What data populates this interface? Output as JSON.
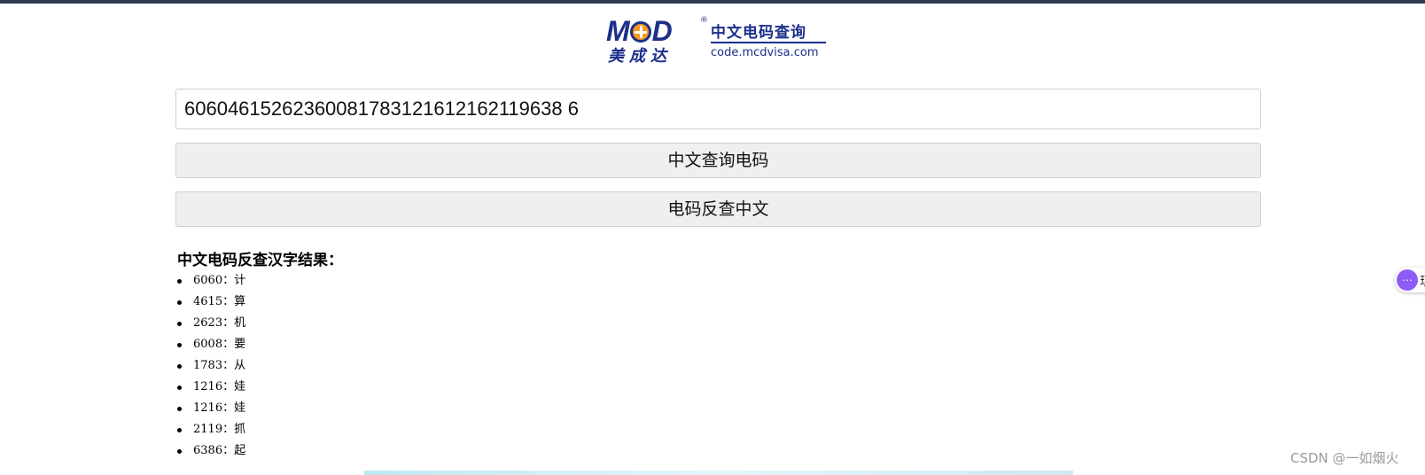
{
  "header": {
    "logo_brand": "MCD",
    "logo_chinese": "美成达",
    "logo_title": "中文电码查询",
    "logo_url": "code.mcdvisa.com"
  },
  "form": {
    "code_value": "60604615262360081783121612162119638 6",
    "query_button": "中文查询电码",
    "reverse_button": "电码反查中文"
  },
  "results": {
    "title": "中文电码反查汉字结果：",
    "items": [
      {
        "code": "6060",
        "char": "计"
      },
      {
        "code": "4615",
        "char": "算"
      },
      {
        "code": "2623",
        "char": "机"
      },
      {
        "code": "6008",
        "char": "要"
      },
      {
        "code": "1783",
        "char": "从"
      },
      {
        "code": "1216",
        "char": "娃"
      },
      {
        "code": "1216",
        "char": "娃"
      },
      {
        "code": "2119",
        "char": "抓"
      },
      {
        "code": "6386",
        "char": "起"
      }
    ]
  },
  "widget": {
    "chat_icon": "chat-bubble-icon",
    "chat_label": "现"
  },
  "watermark": "CSDN @一如烟火",
  "colors": {
    "brand_blue": "#1c2f8a",
    "brand_orange": "#f29a1e",
    "button_bg": "#efefef",
    "widget_purple": "#8b5cf6"
  }
}
